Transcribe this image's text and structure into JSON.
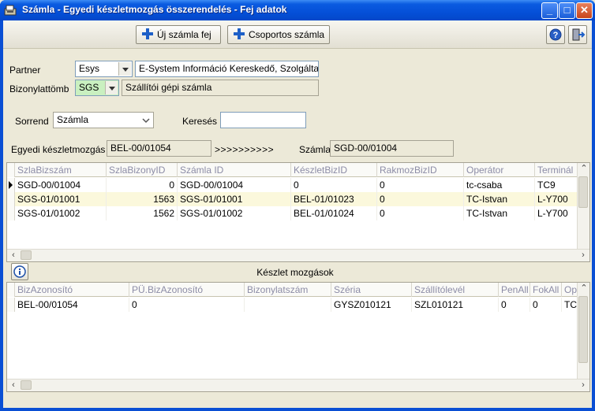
{
  "window": {
    "title": "Számla - Egyedi készletmozgás összerendelés - Fej adatok",
    "minimize": "_",
    "maximize": "□",
    "close": "✕"
  },
  "toolbar": {
    "new_invoice_label": "Új számla fej",
    "group_invoice_label": "Csoportos számla"
  },
  "partner": {
    "label": "Partner",
    "code": "Esys",
    "name": "E-System Információ Kereskedő, Szolgálta"
  },
  "doc_block": {
    "label": "Bizonylattömb",
    "code": "SGS",
    "name": "Szállítói gépi számla"
  },
  "sort": {
    "label": "Sorrend",
    "value": "Számla"
  },
  "search": {
    "label": "Keresés",
    "value": ""
  },
  "link": {
    "movement_label": "Egyedi készletmozgás",
    "movement_value": "BEL-00/01054",
    "arrows": ">>>>>>>>>>",
    "invoice_label": "Számla",
    "invoice_value": "SGD-00/01004"
  },
  "invoice_grid": {
    "columns": [
      "SzlaBizszám",
      "SzlaBizonyID",
      "Számla ID",
      "KészletBizID",
      "RakmozBizID",
      "Operátor",
      "Terminál"
    ],
    "rows": [
      {
        "c0": "SGD-00/01004",
        "c1": "0",
        "c2": "SGD-00/01004",
        "c3": "0",
        "c4": "0",
        "c5": "tc-csaba",
        "c6": "TC9",
        "current": true
      },
      {
        "c0": "SGS-01/01001",
        "c1": "1563",
        "c2": "SGS-01/01001",
        "c3": "BEL-01/01023",
        "c4": "0",
        "c5": "TC-Istvan",
        "c6": "L-Y700",
        "current": false
      },
      {
        "c0": "SGS-01/01002",
        "c1": "1562",
        "c2": "SGS-01/01002",
        "c3": "BEL-01/01024",
        "c4": "0",
        "c5": "TC-Istvan",
        "c6": "L-Y700",
        "current": false
      }
    ]
  },
  "movements": {
    "title": "Készlet mozgások",
    "columns": [
      "BizAzonosító",
      "PÜ.BizAzonosító",
      "Bizonylatszám",
      "Széria",
      "Szállítólevél",
      "PenAll",
      "FokAll",
      "Op"
    ],
    "rows": [
      {
        "c0": "BEL-00/01054",
        "c1": "0",
        "c2": "",
        "c3": "GYSZ010121",
        "c4": "SZL010121",
        "c5": "0",
        "c6": "0",
        "c7": "TC"
      }
    ]
  },
  "colors": {
    "title_bar": "#0a55d8",
    "selected_row": "#fbf8dc",
    "doc_code_bg": "#c9f0c0"
  },
  "icons": {
    "app": "app-icon",
    "help": "help-icon",
    "exit": "exit-icon",
    "info": "info-icon"
  }
}
